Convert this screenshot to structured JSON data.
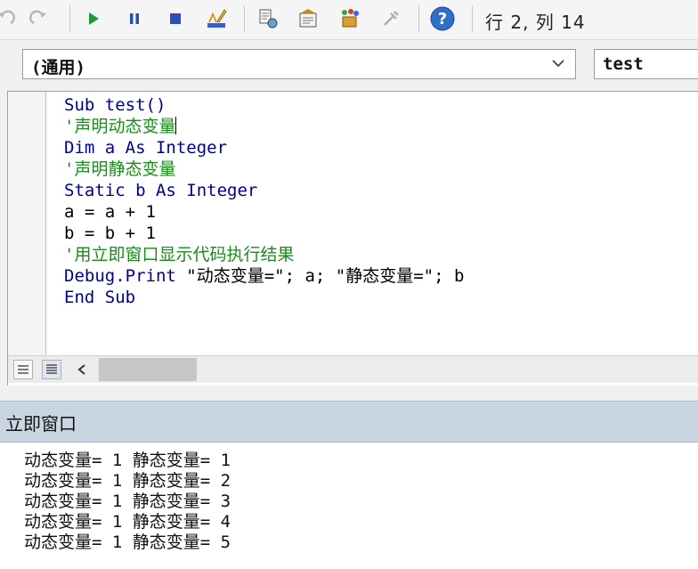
{
  "toolbar": {
    "buttons": [
      {
        "name": "undo-icon"
      },
      {
        "name": "redo-icon"
      },
      {
        "name": "run-icon"
      },
      {
        "name": "pause-icon"
      },
      {
        "name": "reset-icon"
      },
      {
        "name": "design-mode-icon"
      },
      {
        "name": "project-explorer-icon"
      },
      {
        "name": "properties-window-icon"
      },
      {
        "name": "object-browser-icon"
      },
      {
        "name": "toolbox-icon"
      },
      {
        "name": "help-icon"
      }
    ],
    "cursor_position": "行 2, 列 14"
  },
  "object_combo": {
    "value": "(通用)"
  },
  "procedure_combo": {
    "value": "test"
  },
  "code_lines": [
    {
      "type": "keyword",
      "text": "Sub test()"
    },
    {
      "type": "comment",
      "text": "'声明动态变量"
    },
    {
      "type": "keyword",
      "text": "Dim a As Integer"
    },
    {
      "type": "comment",
      "text": "'声明静态变量"
    },
    {
      "type": "keyword",
      "text": "Static b As Integer"
    },
    {
      "type": "plain",
      "text": "a = a + 1"
    },
    {
      "type": "plain",
      "text": "b = b + 1"
    },
    {
      "type": "comment",
      "text": "'用立即窗口显示代码执行结果"
    },
    {
      "type": "mixed",
      "kw": "Debug.Print ",
      "rest": "\"动态变量=\"; a; \"静态变量=\"; b"
    },
    {
      "type": "keyword",
      "text": "End Sub"
    }
  ],
  "immediate_window": {
    "title": "立即窗口",
    "lines": [
      "动态变量= 1 静态变量= 1",
      "动态变量= 1 静态变量= 2",
      "动态变量= 1 静态变量= 3",
      "动态变量= 1 静态变量= 4",
      "动态变量= 1 静态变量= 5"
    ]
  },
  "colors": {
    "keyword": "#00008b",
    "comment": "#1a8c1a",
    "immediate_header": "#c9d5e3"
  }
}
